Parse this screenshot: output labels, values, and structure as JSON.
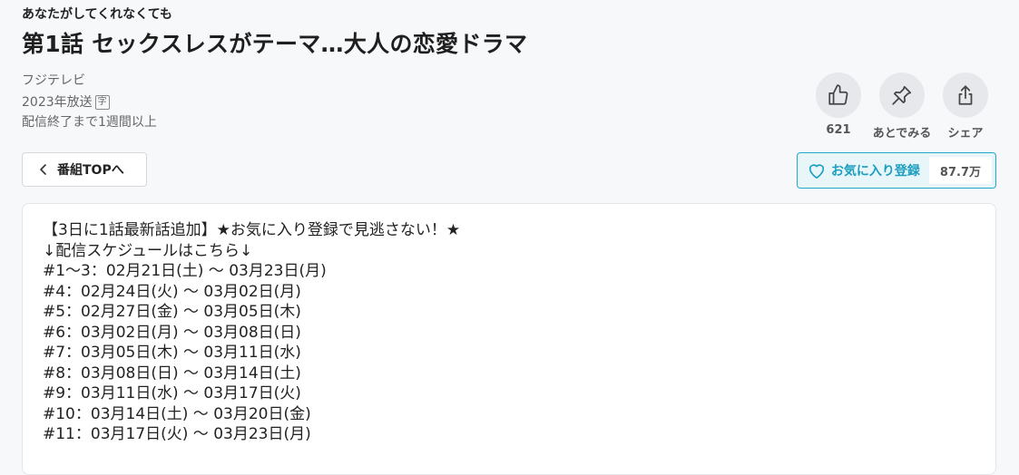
{
  "series": {
    "title": "あなたがしてくれなくても"
  },
  "episode": {
    "title": "第1話 セックスレスがテーマ…大人の恋愛ドラマ"
  },
  "meta": {
    "network": "フジテレビ",
    "broadcast_year": "2023年放送",
    "subtitle_badge": "字",
    "availability": "配信終了まで1週間以上"
  },
  "actions": {
    "like_count": "621",
    "watch_later_label": "あとでみる",
    "share_label": "シェア"
  },
  "nav": {
    "back_label": "番組TOPへ"
  },
  "favorite": {
    "label": "お気に入り登録",
    "count": "87.7万",
    "accent_color": "#1b9ec0"
  },
  "description": {
    "lines": [
      "【3日に1話最新話追加】★お気に入り登録で見逃さない！★",
      "↓配信スケジュールはこちら↓",
      "#1～3：02月21日(土) ～ 03月23日(月)",
      "#4：02月24日(火) ～ 03月02日(月)",
      "#5：02月27日(金) ～ 03月05日(木)",
      "#6：03月02日(月) ～ 03月08日(日)",
      "#7：03月05日(木) ～ 03月11日(水)",
      "#8：03月08日(日) ～ 03月14日(土)",
      "#9：03月11日(水) ～ 03月17日(火)",
      "#10：03月14日(土) ～ 03月20日(金)",
      "#11：03月17日(火) ～ 03月23日(月)"
    ]
  },
  "icons": {
    "like": "thumbs-up-icon",
    "watch_later": "pin-icon",
    "share": "share-icon",
    "back": "chevron-left-icon",
    "favorite": "heart-icon"
  }
}
